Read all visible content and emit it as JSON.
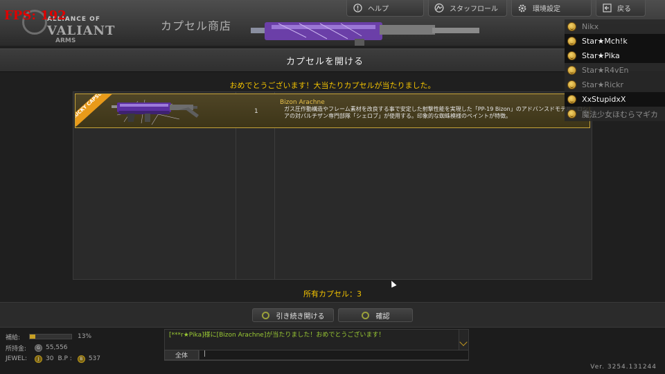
{
  "hud": {
    "fps": "FPS: 192"
  },
  "header": {
    "logo_lines": [
      "ALLIANCE OF",
      "VALIANT",
      "ARMS"
    ],
    "shop_title": "カプセル商店",
    "nav": [
      {
        "label": "ヘルプ",
        "icon": "help-icon"
      },
      {
        "label": "スタッフロール",
        "icon": "staff-icon"
      },
      {
        "label": "環境設定",
        "icon": "gear-icon"
      },
      {
        "label": "戻る",
        "icon": "back-icon"
      }
    ]
  },
  "players": [
    {
      "name": "Nikx",
      "highlight": false
    },
    {
      "name": "Star★Mch!k",
      "highlight": true
    },
    {
      "name": "Star★Pika",
      "highlight": true
    },
    {
      "name": "Star★R4vEn",
      "highlight": false
    },
    {
      "name": "Star★Rickr",
      "highlight": false
    },
    {
      "name": "XxStupidxX",
      "highlight": true
    },
    {
      "name": "魔法少女ほむらマギカ",
      "highlight": false
    }
  ],
  "dialog": {
    "title": "カプセルを開ける",
    "congrats": "おめでとうございます！大当たりカプセルが当たりました。",
    "item": {
      "badge": "LUCKY CAPSULE",
      "quantity": "1",
      "name": "Bizon Arachne",
      "description": "ガス圧作動構造やフレーム素材を改良する事で安定した射撃性能を実現した「PP-19 Bizon」のアドバンスドモデル。ロシアの対パルチザン専門部隊「シェロブ」が使用する。印象的な蜘蛛模様のペイントが特徴。"
    },
    "owned": "所有カプセル：3",
    "buttons": {
      "continue": "引き続き開ける",
      "confirm": "確認"
    }
  },
  "status": {
    "supply_label": "補給:",
    "supply_percent": "13%",
    "supply_fraction": 0.13,
    "money_label": "所持金:",
    "money": "55,556",
    "jewel_label": "JEWEL:",
    "jewel": "30",
    "bp_label": "B.P :",
    "bp": "537"
  },
  "chat": {
    "message": "[***r★Pika]様に[Bizon Arachne]が当たりました！おめでとうございます！",
    "scope": "全体",
    "input": "|"
  },
  "version": "Ver. 3254.131244",
  "colors": {
    "accent_gold": "#f2c200",
    "chat_green": "#9bcb34",
    "highlight_border": "#c7a43a",
    "fps_red": "#e00000"
  }
}
